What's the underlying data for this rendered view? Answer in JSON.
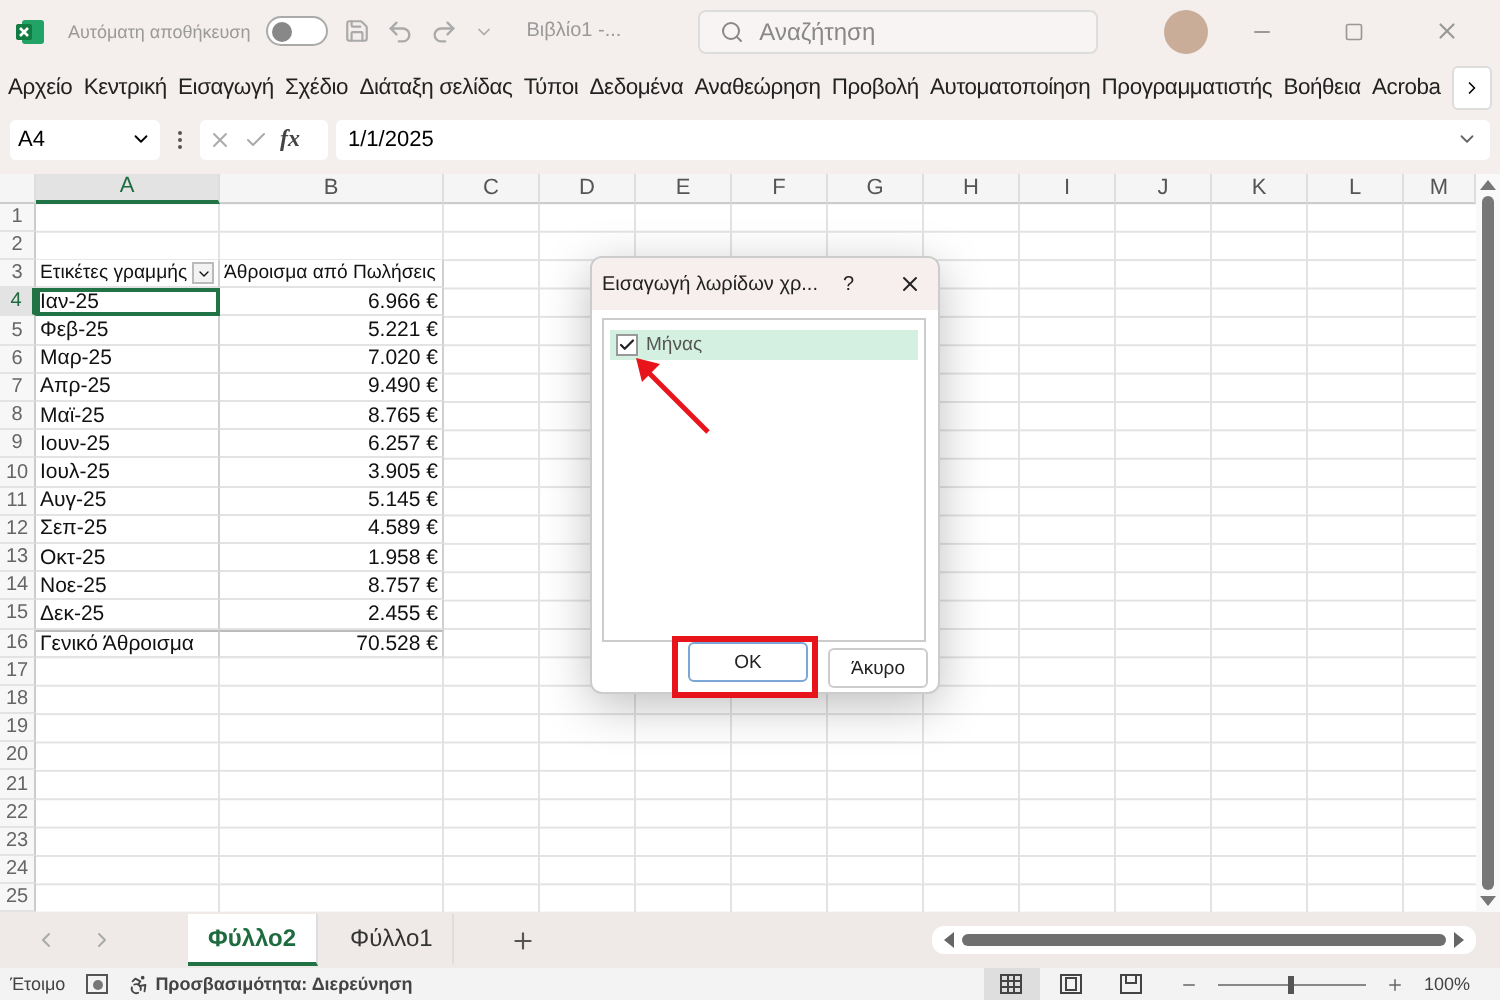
{
  "title_bar": {
    "autosave_label": "Αυτόματη αποθήκευση",
    "autosave": {
      "on": false
    },
    "document_title": "Βιβλίο1 -...",
    "search": {
      "placeholder": "Αναζήτηση"
    }
  },
  "ribbon_tabs": [
    "Αρχείο",
    "Κεντρική",
    "Εισαγωγή",
    "Σχέδιο",
    "Διάταξη σελίδας",
    "Τύποι",
    "Δεδομένα",
    "Αναθεώρηση",
    "Προβολή",
    "Αυτοματοποίηση",
    "Προγραμματιστής",
    "Βοήθεια",
    "Acroba"
  ],
  "formula_bar": {
    "name_box": "A4",
    "fx": "fx",
    "formula": "1/1/2025"
  },
  "columns": [
    {
      "label": "A",
      "selected": true
    },
    {
      "label": "B",
      "selected": false
    },
    {
      "label": "C",
      "selected": false
    },
    {
      "label": "D",
      "selected": false
    },
    {
      "label": "E",
      "selected": false
    },
    {
      "label": "F",
      "selected": false
    },
    {
      "label": "G",
      "selected": false
    },
    {
      "label": "H",
      "selected": false
    },
    {
      "label": "I",
      "selected": false
    },
    {
      "label": "J",
      "selected": false
    },
    {
      "label": "K",
      "selected": false
    },
    {
      "label": "L",
      "selected": false
    },
    {
      "label": "M",
      "selected": false
    }
  ],
  "rows": [
    {
      "number": "1",
      "kind": "empty",
      "selected": false
    },
    {
      "number": "2",
      "kind": "empty",
      "selected": false
    },
    {
      "number": "3",
      "kind": "header",
      "selected": false,
      "cells": [
        "Ετικέτες γραμμής",
        "Άθροισμα από Πωλήσεις"
      ]
    },
    {
      "number": "4",
      "kind": "item",
      "selected": true,
      "cells": [
        "Ιαν-25",
        "6.966 €"
      ]
    },
    {
      "number": "5",
      "kind": "item",
      "selected": false,
      "cells": [
        "Φεβ-25",
        "5.221 €"
      ]
    },
    {
      "number": "6",
      "kind": "item",
      "selected": false,
      "cells": [
        "Μαρ-25",
        "7.020 €"
      ]
    },
    {
      "number": "7",
      "kind": "item",
      "selected": false,
      "cells": [
        "Απρ-25",
        "9.490 €"
      ]
    },
    {
      "number": "8",
      "kind": "item",
      "selected": false,
      "cells": [
        "Μαϊ-25",
        "8.765 €"
      ]
    },
    {
      "number": "9",
      "kind": "item",
      "selected": false,
      "cells": [
        "Ιουν-25",
        "6.257 €"
      ]
    },
    {
      "number": "10",
      "kind": "item",
      "selected": false,
      "cells": [
        "Ιουλ-25",
        "3.905 €"
      ]
    },
    {
      "number": "11",
      "kind": "item",
      "selected": false,
      "cells": [
        "Αυγ-25",
        "5.145 €"
      ]
    },
    {
      "number": "12",
      "kind": "item",
      "selected": false,
      "cells": [
        "Σεπ-25",
        "4.589 €"
      ]
    },
    {
      "number": "13",
      "kind": "item",
      "selected": false,
      "cells": [
        "Οκτ-25",
        "1.958 €"
      ]
    },
    {
      "number": "14",
      "kind": "item",
      "selected": false,
      "cells": [
        "Νοε-25",
        "8.757 €"
      ]
    },
    {
      "number": "15",
      "kind": "item",
      "selected": false,
      "cells": [
        "Δεκ-25",
        "2.455 €"
      ]
    },
    {
      "number": "16",
      "kind": "total",
      "selected": false,
      "cells": [
        "Γενικό Άθροισμα",
        "70.528 €"
      ]
    },
    {
      "number": "17",
      "kind": "empty",
      "selected": false
    },
    {
      "number": "18",
      "kind": "empty",
      "selected": false
    },
    {
      "number": "19",
      "kind": "empty",
      "selected": false
    },
    {
      "number": "20",
      "kind": "empty",
      "selected": false
    },
    {
      "number": "21",
      "kind": "empty",
      "selected": false
    },
    {
      "number": "22",
      "kind": "empty",
      "selected": false
    },
    {
      "number": "23",
      "kind": "empty",
      "selected": false
    },
    {
      "number": "24",
      "kind": "empty",
      "selected": false
    },
    {
      "number": "25",
      "kind": "empty",
      "selected": false
    }
  ],
  "sheet_tabs": [
    {
      "label": "Φύλλο2",
      "selected": true
    },
    {
      "label": "Φύλλο1",
      "selected": false
    }
  ],
  "status_bar": {
    "status": "Έτοιμο",
    "accessibility": "Προσβασιμότητα: Διερεύνηση",
    "views": [
      {
        "kind": "normal",
        "selected": true
      },
      {
        "kind": "page_layout",
        "selected": false
      },
      {
        "kind": "page_break",
        "selected": false
      }
    ],
    "zoom": {
      "level": 0.5,
      "reading": "100%"
    }
  },
  "dialog": {
    "title": "Εισαγωγή λωρίδων χρ...",
    "help": "?",
    "items": [
      {
        "label": "Μήνας",
        "checked": true,
        "selected": true
      }
    ],
    "buttons": [
      {
        "label": "OK",
        "kind": "primary"
      },
      {
        "label": "Άκυρο",
        "kind": "secondary"
      }
    ],
    "annotations": {
      "arrow": true,
      "ok_frame": true
    }
  }
}
